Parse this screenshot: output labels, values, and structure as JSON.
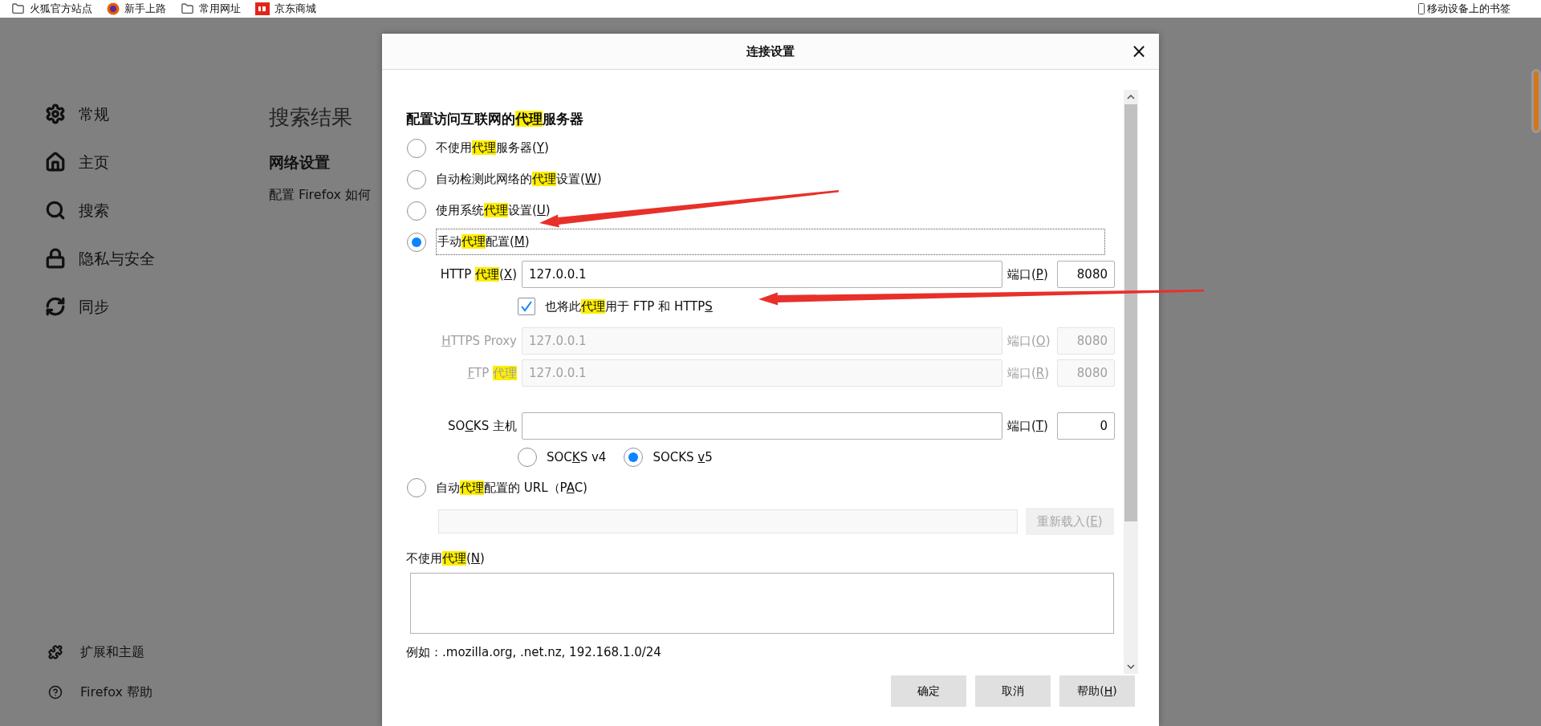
{
  "bookmarks": {
    "items": [
      {
        "label": "火狐官方站点"
      },
      {
        "label": "新手上路"
      },
      {
        "label": "常用网址"
      },
      {
        "label": "京东商城"
      }
    ],
    "mobile": {
      "label": "移动设备上的书签"
    }
  },
  "sidebar": {
    "items": [
      {
        "label": "常规"
      },
      {
        "label": "主页"
      },
      {
        "label": "搜索"
      },
      {
        "label": "隐私与安全"
      },
      {
        "label": "同步"
      }
    ],
    "footer_items": [
      {
        "label": "扩展和主题"
      },
      {
        "label": "Firefox 帮助"
      }
    ]
  },
  "content": {
    "heading": "搜索结果",
    "section_title": "网络设置",
    "description": "配置 Firefox 如何"
  },
  "dialog": {
    "title": "连接设置",
    "close": "×",
    "heading": [
      {
        "text": "配置访问互联网的",
        "kind": "plain"
      },
      {
        "text": "代理",
        "kind": "highlight"
      },
      {
        "text": "服务器",
        "kind": "plain"
      }
    ],
    "proxy_modes": [
      {
        "selected": false,
        "label": [
          {
            "text": "不使用",
            "kind": "plain"
          },
          {
            "text": "代理",
            "kind": "highlight"
          },
          {
            "text": "服务器(",
            "kind": "plain"
          },
          {
            "text": "Y",
            "kind": "accesskey"
          },
          {
            "text": ")",
            "kind": "plain"
          }
        ]
      },
      {
        "selected": false,
        "label": [
          {
            "text": "自动检测此网络的",
            "kind": "plain"
          },
          {
            "text": "代理",
            "kind": "highlight"
          },
          {
            "text": "设置(",
            "kind": "plain"
          },
          {
            "text": "W",
            "kind": "accesskey"
          },
          {
            "text": ")",
            "kind": "plain"
          }
        ]
      },
      {
        "selected": false,
        "label": [
          {
            "text": "使用系统",
            "kind": "plain"
          },
          {
            "text": "代理",
            "kind": "highlight"
          },
          {
            "text": "设置(",
            "kind": "plain"
          },
          {
            "text": "U",
            "kind": "accesskey"
          },
          {
            "text": ")",
            "kind": "plain"
          }
        ]
      },
      {
        "selected": true,
        "label": [
          {
            "text": "手动",
            "kind": "plain"
          },
          {
            "text": "代理",
            "kind": "highlight"
          },
          {
            "text": "配置(",
            "kind": "plain"
          },
          {
            "text": "M",
            "kind": "accesskey"
          },
          {
            "text": ")",
            "kind": "plain"
          }
        ]
      }
    ],
    "http": {
      "disabled": false,
      "label": [
        {
          "text": "HTTP ",
          "kind": "plain"
        },
        {
          "text": "代理",
          "kind": "highlight"
        },
        {
          "text": "(",
          "kind": "plain"
        },
        {
          "text": "X",
          "kind": "accesskey"
        },
        {
          "text": ")",
          "kind": "plain"
        }
      ],
      "value": "127.0.0.1",
      "port_label": [
        {
          "text": "端口(",
          "kind": "plain"
        },
        {
          "text": "P",
          "kind": "accesskey"
        },
        {
          "text": ")",
          "kind": "plain"
        }
      ],
      "port": "8080"
    },
    "share_checkbox": {
      "checked": true,
      "label": [
        {
          "text": "也将此",
          "kind": "plain"
        },
        {
          "text": "代理",
          "kind": "highlight"
        },
        {
          "text": "用于 FTP 和 HTTP",
          "kind": "plain"
        },
        {
          "text": "S",
          "kind": "accesskey"
        }
      ]
    },
    "other_proxies": [
      {
        "disabled": true,
        "label": [
          {
            "text": "H",
            "kind": "accesskey"
          },
          {
            "text": "TTPS Proxy",
            "kind": "plain"
          }
        ],
        "value": "127.0.0.1",
        "port_label": [
          {
            "text": "端口(",
            "kind": "plain"
          },
          {
            "text": "O",
            "kind": "accesskey"
          },
          {
            "text": ")",
            "kind": "plain"
          }
        ],
        "port": "8080"
      },
      {
        "disabled": true,
        "label": [
          {
            "text": "F",
            "kind": "accesskey"
          },
          {
            "text": "TP ",
            "kind": "plain"
          },
          {
            "text": "代理",
            "kind": "highlight"
          }
        ],
        "value": "127.0.0.1",
        "port_label": [
          {
            "text": "端口(",
            "kind": "plain"
          },
          {
            "text": "R",
            "kind": "accesskey"
          },
          {
            "text": ")",
            "kind": "plain"
          }
        ],
        "port": "8080"
      }
    ],
    "socks": {
      "disabled": false,
      "label": [
        {
          "text": "SO",
          "kind": "plain"
        },
        {
          "text": "C",
          "kind": "accesskey"
        },
        {
          "text": "KS 主机",
          "kind": "plain"
        }
      ],
      "port_label": [
        {
          "text": "端口(",
          "kind": "plain"
        },
        {
          "text": "T",
          "kind": "accesskey"
        },
        {
          "text": ")",
          "kind": "plain"
        }
      ],
      "port": "0"
    },
    "socks_versions": [
      {
        "selected": false,
        "label": [
          {
            "text": "SOC",
            "kind": "plain"
          },
          {
            "text": "K",
            "kind": "accesskey"
          },
          {
            "text": "S v4",
            "kind": "plain"
          }
        ]
      },
      {
        "selected": true,
        "label": [
          {
            "text": "SOCKS ",
            "kind": "plain"
          },
          {
            "text": "v",
            "kind": "accesskey"
          },
          {
            "text": "5",
            "kind": "plain"
          }
        ]
      }
    ],
    "pac_mode": {
      "selected": false,
      "label": [
        {
          "text": "自动",
          "kind": "plain"
        },
        {
          "text": "代理",
          "kind": "highlight"
        },
        {
          "text": "配置的 URL（P",
          "kind": "plain"
        },
        {
          "text": "A",
          "kind": "accesskey"
        },
        {
          "text": "C)",
          "kind": "plain"
        }
      ]
    },
    "reload_button": {
      "disabled": true,
      "label": [
        {
          "text": "重新载入(",
          "kind": "plain"
        },
        {
          "text": "E",
          "kind": "accesskey"
        },
        {
          "text": ")",
          "kind": "plain"
        }
      ]
    },
    "no_proxy_label": [
      {
        "text": "不使用",
        "kind": "plain"
      },
      {
        "text": "代理",
        "kind": "highlight"
      },
      {
        "text": "(",
        "kind": "plain"
      },
      {
        "text": "N",
        "kind": "accesskey"
      },
      {
        "text": ")",
        "kind": "plain"
      }
    ],
    "example": "例如：.mozilla.org, .net.nz, 192.168.1.0/24",
    "buttons": [
      {
        "label": [
          {
            "text": "确定",
            "kind": "plain"
          }
        ]
      },
      {
        "label": [
          {
            "text": "取消",
            "kind": "plain"
          }
        ]
      },
      {
        "label": [
          {
            "text": "帮助(",
            "kind": "plain"
          },
          {
            "text": "H",
            "kind": "accesskey"
          },
          {
            "text": ")",
            "kind": "plain"
          }
        ]
      }
    ]
  }
}
